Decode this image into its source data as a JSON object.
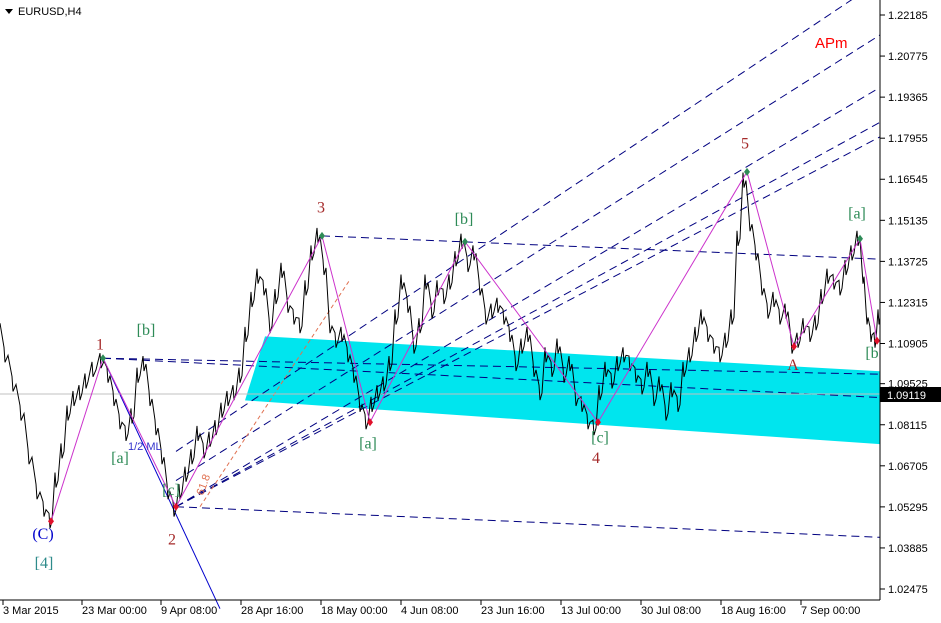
{
  "title": "EURUSD,H4",
  "chart_data": {
    "type": "candlestick-line",
    "symbol": "EURUSD",
    "timeframe": "H4",
    "ylim": [
      1.018,
      1.229
    ],
    "y_ticks": [
      "1.22185",
      "1.20775",
      "1.19365",
      "1.17955",
      "1.16545",
      "1.15135",
      "1.13725",
      "1.12315",
      "1.10905",
      "1.09525",
      "1.08115",
      "1.06705",
      "1.05295",
      "1.03885",
      "1.02475"
    ],
    "x_ticks": [
      "3 Mar 2015",
      "23 Mar 00:00",
      "9 Apr 08:00",
      "28 Apr 16:00",
      "18 May 00:00",
      "4 Jun 08:00",
      "23 Jun 16:00",
      "13 Jul 00:00",
      "30 Jul 08:00",
      "18 Aug 16:00",
      "7 Sep 00:00"
    ],
    "current_price": "1.09119",
    "price_path": [
      [
        0,
        1.116
      ],
      [
        8,
        1.105
      ],
      [
        16,
        1.095
      ],
      [
        24,
        1.085
      ],
      [
        32,
        1.07
      ],
      [
        40,
        1.058
      ],
      [
        46,
        1.052
      ],
      [
        52,
        1.048
      ],
      [
        58,
        1.062
      ],
      [
        64,
        1.072
      ],
      [
        70,
        1.085
      ],
      [
        76,
        1.09
      ],
      [
        82,
        1.092
      ],
      [
        88,
        1.096
      ],
      [
        96,
        1.1
      ],
      [
        104,
        1.103
      ],
      [
        110,
        1.098
      ],
      [
        116,
        1.09
      ],
      [
        122,
        1.082
      ],
      [
        128,
        1.078
      ],
      [
        134,
        1.084
      ],
      [
        140,
        1.098
      ],
      [
        146,
        1.102
      ],
      [
        152,
        1.09
      ],
      [
        158,
        1.08
      ],
      [
        164,
        1.07
      ],
      [
        170,
        1.058
      ],
      [
        176,
        1.052
      ],
      [
        182,
        1.058
      ],
      [
        188,
        1.064
      ],
      [
        194,
        1.07
      ],
      [
        200,
        1.078
      ],
      [
        206,
        1.072
      ],
      [
        212,
        1.076
      ],
      [
        218,
        1.08
      ],
      [
        224,
        1.086
      ],
      [
        230,
        1.09
      ],
      [
        236,
        1.092
      ],
      [
        242,
        1.098
      ],
      [
        248,
        1.112
      ],
      [
        254,
        1.124
      ],
      [
        260,
        1.132
      ],
      [
        266,
        1.128
      ],
      [
        272,
        1.115
      ],
      [
        278,
        1.125
      ],
      [
        284,
        1.134
      ],
      [
        290,
        1.122
      ],
      [
        296,
        1.118
      ],
      [
        302,
        1.115
      ],
      [
        308,
        1.128
      ],
      [
        314,
        1.14
      ],
      [
        320,
        1.146
      ],
      [
        326,
        1.135
      ],
      [
        332,
        1.115
      ],
      [
        338,
        1.11
      ],
      [
        344,
        1.112
      ],
      [
        350,
        1.105
      ],
      [
        356,
        1.098
      ],
      [
        362,
        1.088
      ],
      [
        368,
        1.082
      ],
      [
        374,
        1.088
      ],
      [
        380,
        1.092
      ],
      [
        386,
        1.095
      ],
      [
        392,
        1.102
      ],
      [
        398,
        1.118
      ],
      [
        404,
        1.13
      ],
      [
        410,
        1.122
      ],
      [
        416,
        1.108
      ],
      [
        422,
        1.115
      ],
      [
        428,
        1.13
      ],
      [
        434,
        1.12
      ],
      [
        440,
        1.128
      ],
      [
        446,
        1.125
      ],
      [
        452,
        1.13
      ],
      [
        458,
        1.138
      ],
      [
        464,
        1.144
      ],
      [
        470,
        1.136
      ],
      [
        476,
        1.14
      ],
      [
        482,
        1.128
      ],
      [
        488,
        1.118
      ],
      [
        494,
        1.12
      ],
      [
        500,
        1.122
      ],
      [
        506,
        1.118
      ],
      [
        512,
        1.112
      ],
      [
        518,
        1.102
      ],
      [
        524,
        1.108
      ],
      [
        530,
        1.112
      ],
      [
        536,
        1.1
      ],
      [
        542,
        1.092
      ],
      [
        548,
        1.105
      ],
      [
        554,
        1.1
      ],
      [
        560,
        1.108
      ],
      [
        566,
        1.098
      ],
      [
        572,
        1.102
      ],
      [
        578,
        1.09
      ],
      [
        584,
        1.088
      ],
      [
        590,
        1.082
      ],
      [
        596,
        1.08
      ],
      [
        602,
        1.092
      ],
      [
        608,
        1.1
      ],
      [
        614,
        1.096
      ],
      [
        620,
        1.102
      ],
      [
        626,
        1.105
      ],
      [
        632,
        1.102
      ],
      [
        638,
        1.098
      ],
      [
        644,
        1.094
      ],
      [
        650,
        1.1
      ],
      [
        656,
        1.09
      ],
      [
        662,
        1.095
      ],
      [
        668,
        1.085
      ],
      [
        674,
        1.093
      ],
      [
        680,
        1.088
      ],
      [
        686,
        1.1
      ],
      [
        692,
        1.105
      ],
      [
        698,
        1.112
      ],
      [
        704,
        1.118
      ],
      [
        710,
        1.112
      ],
      [
        716,
        1.108
      ],
      [
        722,
        1.105
      ],
      [
        728,
        1.11
      ],
      [
        734,
        1.118
      ],
      [
        740,
        1.145
      ],
      [
        746,
        1.165
      ],
      [
        752,
        1.15
      ],
      [
        758,
        1.14
      ],
      [
        764,
        1.128
      ],
      [
        770,
        1.12
      ],
      [
        776,
        1.124
      ],
      [
        782,
        1.118
      ],
      [
        788,
        1.12
      ],
      [
        794,
        1.108
      ],
      [
        800,
        1.11
      ],
      [
        806,
        1.115
      ],
      [
        812,
        1.112
      ],
      [
        818,
        1.116
      ],
      [
        824,
        1.125
      ],
      [
        830,
        1.132
      ],
      [
        836,
        1.13
      ],
      [
        842,
        1.128
      ],
      [
        848,
        1.135
      ],
      [
        854,
        1.14
      ],
      [
        860,
        1.145
      ],
      [
        864,
        1.132
      ],
      [
        868,
        1.118
      ],
      [
        872,
        1.112
      ],
      [
        876,
        1.11
      ],
      [
        880,
        1.118
      ]
    ],
    "wave_zigzag": [
      [
        51,
        1.048
      ],
      [
        103,
        1.104
      ],
      [
        176,
        1.053
      ],
      [
        322,
        1.146
      ],
      [
        370,
        1.082
      ],
      [
        465,
        1.144
      ],
      [
        598,
        1.082
      ],
      [
        747,
        1.168
      ],
      [
        794,
        1.108
      ],
      [
        860,
        1.145
      ],
      [
        877,
        1.11
      ]
    ],
    "wave_labels": [
      {
        "text": "1",
        "price": 1.107,
        "color": "#a52a2a",
        "bar": 100
      },
      {
        "text": "2",
        "price": 1.04,
        "color": "#a52a2a",
        "bar": 172
      },
      {
        "text": "3",
        "price": 1.154,
        "color": "#a52a2a",
        "bar": 321
      },
      {
        "text": "4",
        "price": 1.068,
        "color": "#a52a2a",
        "bar": 596
      },
      {
        "text": "5",
        "price": 1.176,
        "color": "#a52a2a",
        "bar": 745
      },
      {
        "text": "A",
        "price": 1.1,
        "color": "#a52a2a",
        "bar": 793
      },
      {
        "text": "(C)",
        "price": 1.042,
        "color": "#0000cc",
        "bar": 43
      },
      {
        "text": "[4]",
        "price": 1.032,
        "color": "#2e8b8b",
        "bar": 44
      },
      {
        "text": "[a]",
        "price": 1.068,
        "color": "#2e8b57",
        "bar": 120
      },
      {
        "text": "[b]",
        "price": 1.112,
        "color": "#2e8b57",
        "bar": 146
      },
      {
        "text": "[c]",
        "price": 1.057,
        "color": "#2e8b57",
        "bar": 171
      },
      {
        "text": "[a]",
        "price": 1.073,
        "color": "#2e8b57",
        "bar": 368
      },
      {
        "text": "[b]",
        "price": 1.15,
        "color": "#2e8b57",
        "bar": 464
      },
      {
        "text": "[c]",
        "price": 1.075,
        "color": "#2e8b57",
        "bar": 600
      },
      {
        "text": "[a]",
        "price": 1.152,
        "color": "#2e8b57",
        "bar": 857
      },
      {
        "text": "[b",
        "price": 1.104,
        "color": "#2e8b57",
        "bar": 872
      }
    ],
    "annotations": {
      "apm": "APm",
      "ml_label": "1/2 ML",
      "fib_label": "61.8"
    }
  },
  "colors": {
    "price": "#000000",
    "zigzag": "#cc33cc",
    "channel": "#00e5ee",
    "dash": "#000080",
    "top_marker": "#2e8b57",
    "bottom_marker": "#e0102a",
    "apm": "#ff0000"
  }
}
